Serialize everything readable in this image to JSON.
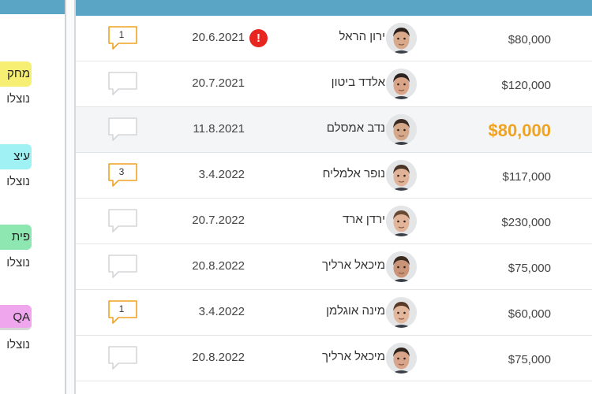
{
  "sidebar": {
    "groups": [
      {
        "label": "מחק",
        "sub": "נוצלו",
        "color": "#f7ef73"
      },
      {
        "label": "עיצ",
        "sub": "נוצלו",
        "color": "#9ff1f4"
      },
      {
        "label": "פית",
        "sub": "נוצלו",
        "color": "#8ee7b1"
      },
      {
        "label": "QA",
        "sub": "נוצלו",
        "color": "#efa6ec"
      }
    ]
  },
  "rows": [
    {
      "comments": "1",
      "date": "20.6.2021",
      "alert": "!",
      "name": "ירון הראל",
      "amount": "$80,000",
      "skin": "#d8a98a",
      "hair": "#2a1f1a"
    },
    {
      "comments": "",
      "date": "20.7.2021",
      "alert": "",
      "name": "אלדד ביטון",
      "amount": "$120,000",
      "skin": "#d9a487",
      "hair": "#2b2320"
    },
    {
      "comments": "",
      "date": "11.8.2021",
      "alert": "",
      "name": "נדב אמסלם",
      "amount": "$80,000",
      "skin": "#d6a88a",
      "hair": "#3a2b22"
    },
    {
      "comments": "3",
      "date": "3.4.2022",
      "alert": "",
      "name": "נופר אלמליח",
      "amount": "$117,000",
      "skin": "#e0b399",
      "hair": "#4a3426"
    },
    {
      "comments": "",
      "date": "20.7.2022",
      "alert": "",
      "name": "ירדן ארד",
      "amount": "$230,000",
      "skin": "#e2b59a",
      "hair": "#6a4a32"
    },
    {
      "comments": "",
      "date": "20.8.2022",
      "alert": "",
      "name": "מיכאל ארליך",
      "amount": "$75,000",
      "skin": "#c99478",
      "hair": "#3b2a20"
    },
    {
      "comments": "1",
      "date": "3.4.2022",
      "alert": "",
      "name": "מינה אוגלמן",
      "amount": "$60,000",
      "skin": "#e3b79c",
      "hair": "#5a3a26"
    },
    {
      "comments": "",
      "date": "20.8.2022",
      "alert": "",
      "name": "מיכאל ארליך",
      "amount": "$75,000",
      "skin": "#d8a58a",
      "hair": "#2e231d"
    }
  ],
  "highlight_row": 2,
  "colors": {
    "header": "#5aa5c6",
    "highlight_amount": "#f0a323",
    "comment_active": "#f0a323",
    "comment_empty": "#d3d6d9",
    "alert": "#e8251f"
  }
}
